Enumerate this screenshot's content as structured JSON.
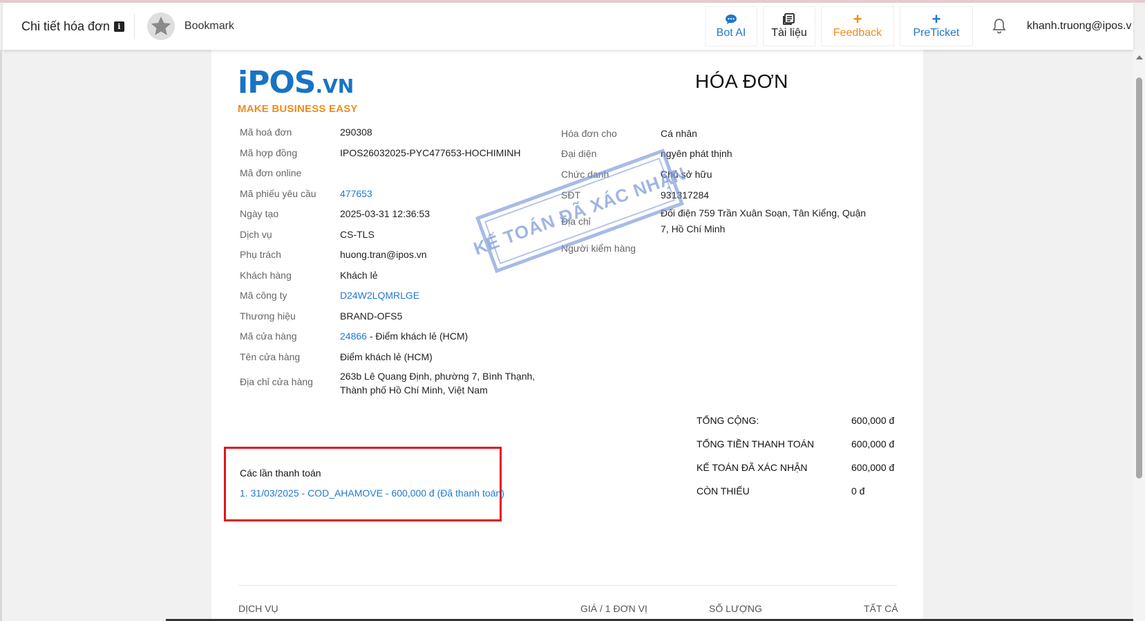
{
  "header": {
    "title": "Chi tiết hóa đơn",
    "bookmark_label": "Bookmark",
    "nav": {
      "bot_ai": "Bot AI",
      "docs": "Tài liệu",
      "feedback": "Feedback",
      "preticket": "PreTicket"
    },
    "user_email": "khanh.truong@ipos.vn"
  },
  "colors": {
    "brand_blue": "#1873c6",
    "brand_orange": "#f08c1a",
    "link_blue": "#1e78d2",
    "highlight_red": "#e5121a"
  },
  "invoice": {
    "logo_text": "iPOS",
    "logo_suffix": ".VN",
    "logo_tagline": "MAKE BUSINESS EASY",
    "title": "HÓA ĐƠN",
    "stamp_text": "KẾ TOÁN ĐÃ XÁC NHẬN",
    "left_fields": [
      {
        "label": "Mã hoá đơn",
        "value": "290308"
      },
      {
        "label": "Mã hợp đồng",
        "value": "IPOS26032025-PYC477653-HOCHIMINH"
      },
      {
        "label": "Mã đơn online",
        "value": ""
      },
      {
        "label": "Mã phiếu yêu cầu",
        "value": "477653"
      },
      {
        "label": "Ngày tạo",
        "value": "2025-03-31 12:36:53"
      },
      {
        "label": "Dịch vụ",
        "value": "CS-TLS"
      },
      {
        "label": "Phụ trách",
        "value": "huong.tran@ipos.vn"
      },
      {
        "label": "Khách hàng",
        "value": "Khách lẻ"
      },
      {
        "label": "Mã công ty",
        "value": "D24W2LQMRLGE"
      },
      {
        "label": "Thương hiệu",
        "value": "BRAND-OFS5"
      },
      {
        "label": "Mã cửa hàng",
        "value": "24866",
        "suffix": " - Điểm khách lẻ (HCM)"
      },
      {
        "label": "Tên cửa hàng",
        "value": "Điểm khách lẻ (HCM)"
      },
      {
        "label": "Địa chỉ cửa hàng",
        "value_line1": "263b Lê Quang Định, phường 7, Bình Thạnh,",
        "value_line2": "Thành phố Hồ Chí Minh, Việt Nam"
      }
    ],
    "right_fields": [
      {
        "label": "Hóa đơn cho",
        "value": "Cá nhân"
      },
      {
        "label": "Đại diện",
        "value": "ngyên phát thịnh"
      },
      {
        "label": "Chức danh",
        "value": "Chủ sở hữu"
      },
      {
        "label": "SĐT",
        "value": "931317284"
      },
      {
        "label": "Địa chỉ",
        "value_line1": "Đối điện 759 Trần Xuân Soạn, Tân Kiểng, Quận",
        "value_line2": "7, Hồ Chí Minh"
      },
      {
        "label": "Người kiểm hàng",
        "value": ""
      }
    ],
    "payments": {
      "title": "Các lần thanh toán",
      "items": [
        "1. 31/03/2025 - COD_AHAMOVE - 600,000 đ (Đã thanh toán)"
      ]
    },
    "totals": [
      {
        "label": "TỔNG CỘNG:",
        "value": "600,000 đ"
      },
      {
        "label": "TỔNG TIỀN THANH TOÁN",
        "value": "600,000 đ"
      },
      {
        "label": "KẾ TOÁN ĐÃ XÁC NHẬN",
        "value": "600,000 đ"
      },
      {
        "label": "CÒN THIẾU",
        "value": "0 đ"
      }
    ],
    "table_headers": [
      "DỊCH VỤ",
      "GIÁ / 1 ĐƠN VỊ",
      "SỐ LƯỢNG",
      "TẤT CẢ"
    ]
  }
}
